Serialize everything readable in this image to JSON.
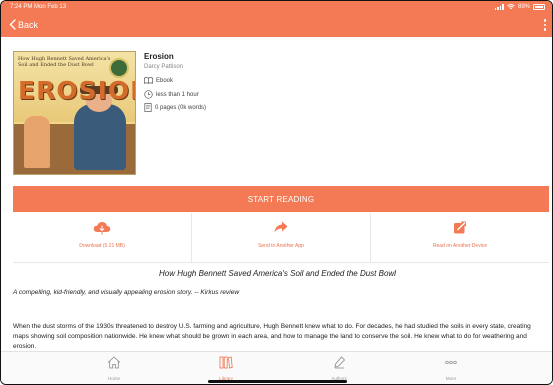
{
  "status": {
    "time": "7:24 PM  Mon Feb 13",
    "battery": "89%"
  },
  "nav": {
    "back_label": "Back"
  },
  "book": {
    "title": "Erosion",
    "author": "Darcy Pattison",
    "format": "Ebook",
    "duration": "less than 1 hour",
    "pages": "0 pages (0k words)",
    "cover": {
      "heading": "How Hugh Bennett Saved America's Soil and Ended the Dust Bowl",
      "big_title": "EROSION"
    }
  },
  "start_label": "START READING",
  "actions": [
    {
      "label": "Download (5.21 MB)",
      "icon": "cloud-download-icon"
    },
    {
      "label": "Send to Another App",
      "icon": "share-arrow-icon"
    },
    {
      "label": "Read on Another Device",
      "icon": "external-link-icon"
    }
  ],
  "subtitle": "How Hugh Bennett Saved America's Soil and Ended the Dust Bowl",
  "review": "A compelling, kid-friendly, and visually appealing erosion story. -- Kirkus review",
  "description": "When the dust storms of the 1930s threatened to destroy U.S. farming and agriculture, Hugh Bennett knew what to do. For decades, he had studied the soils in every state, creating maps showing soil composition nationwide. He knew what should be grown in each area, and how to manage the land to conserve the soil. He knew what to do for weathering and erosion.",
  "tabs": [
    {
      "label": "Home",
      "icon": "home-icon"
    },
    {
      "label": "Library",
      "icon": "library-icon",
      "active": true
    },
    {
      "label": "Authors",
      "icon": "authors-icon"
    },
    {
      "label": "More",
      "icon": "more-icon"
    }
  ],
  "colors": {
    "accent": "#f37a55"
  }
}
